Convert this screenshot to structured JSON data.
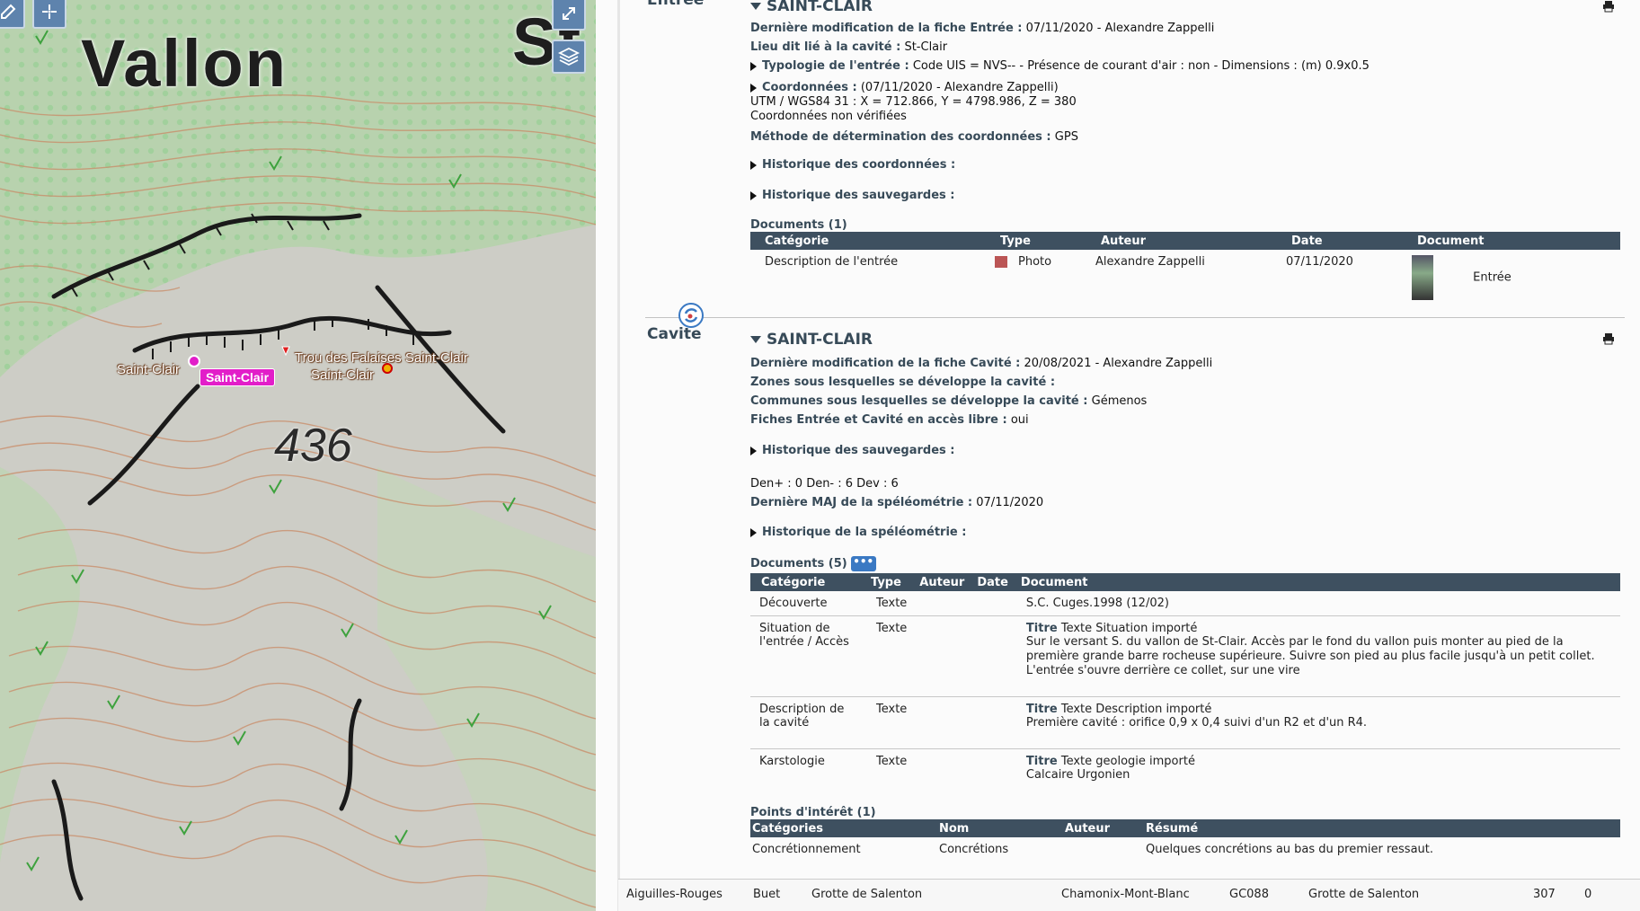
{
  "map": {
    "labels": {
      "vallon": "Vallon",
      "st": "St",
      "altitude": "436",
      "saint_clair_left": "Saint-Clair",
      "saint_clair_badge": "Saint-Clair",
      "trou": "Trou des Falaises Saint-Clair",
      "saint_clair_right": "Saint-Clair"
    },
    "buttons": {
      "fullscreen_icon": "expand-icon",
      "layers_icon": "layers-icon"
    },
    "colors": {
      "badge": "#e21ec9",
      "button": "#5e83ad"
    }
  },
  "entree": {
    "section_label": "Entrée",
    "title": "SAINT-CLAIR",
    "last_mod_label": "Dernière modification de la fiche Entrée :",
    "last_mod_value": "07/11/2020 - Alexandre Zappelli",
    "lieu_label": "Lieu dit lié à la cavité :",
    "lieu_value": "St-Clair",
    "typologie_label": "Typologie de l'entrée :",
    "typologie_value": "Code UIS = NVS--  -  Présence de courant d'air : non  -  Dimensions : (m) 0.9x0.5",
    "coord_label": "Coordonnées :",
    "coord_value": "(07/11/2020 - Alexandre Zappelli)",
    "utm": "UTM / WGS84 31 : X = 712.866, Y = 4798.986, Z = 380",
    "coord_status": "Coordonnées non vérifiées",
    "methode_label": "Méthode de détermination des coordonnées :",
    "methode_value": "GPS",
    "hist_coord": "Historique des coordonnées :",
    "hist_sauv": "Historique des sauvegardes :",
    "documents_title": "Documents (1)",
    "doc_headers": [
      "Catégorie",
      "Type",
      "Auteur",
      "Date",
      "Document"
    ],
    "doc_row": {
      "categorie": "Description de l'entrée",
      "type": "Photo",
      "auteur": "Alexandre Zappelli",
      "date": "07/11/2020",
      "document": "Entrée"
    }
  },
  "cavite": {
    "section_label": "Cavite",
    "title": "SAINT-CLAIR",
    "last_mod_label": "Dernière modification de la fiche Cavité :",
    "last_mod_value": "20/08/2021 - Alexandre Zappelli",
    "zones_label": "Zones sous lesquelles se développe la cavité :",
    "communes_label": "Communes sous lesquelles se développe la cavité :",
    "communes_value": "Gémenos",
    "fiches_label": "Fiches Entrée et Cavité en accès libre :",
    "fiches_value": "oui",
    "hist_sauv": "Historique des sauvegardes :",
    "den": "Den+ : 0 Den- : 6 Dev : 6",
    "maj_label": "Dernière MAJ de la spéléométrie :",
    "maj_value": "07/11/2020",
    "hist_speleo": "Historique de la spéléométrie :",
    "documents_title": "Documents (5)",
    "more_label": "•••",
    "doc_headers": [
      "Catégorie",
      "Type",
      "Auteur",
      "Date",
      "Document"
    ],
    "doc_rows": [
      {
        "categorie": "Découverte",
        "type": "Texte",
        "titre": "",
        "document": "S.C. Cuges.1998 (12/02)"
      },
      {
        "categorie": "Situation de l'entrée / Accès",
        "type": "Texte",
        "titre": "Titre",
        "document": "Texte Situation importé",
        "body": "Sur le versant S. du vallon de St-Clair. Accès par le fond du vallon puis monter au pied de la première grande barre rocheuse supérieure. Suivre son pied au plus facile jusqu'à un petit collet. L'entrée s'ouvre derrière ce collet, sur une vire"
      },
      {
        "categorie": "Description de la cavité",
        "type": "Texte",
        "titre": "Titre",
        "document": "Texte Description importé",
        "body": "Première cavité : orifice 0,9 x 0,4 suivi d'un R2 et d'un R4."
      },
      {
        "categorie": "Karstologie",
        "type": "Texte",
        "titre": "Titre",
        "document": "Texte geologie importé",
        "body": "Calcaire Urgonien"
      }
    ],
    "points_title": "Points d'intérêt (1)",
    "points_headers": [
      "Catégories",
      "Nom",
      "Auteur",
      "Résumé"
    ],
    "points_row": {
      "categorie": "Concrétionnement",
      "nom": "Concrétions",
      "auteur": "",
      "resume": "Quelques concrétions au bas du premier ressaut."
    }
  },
  "bottom_row": {
    "massif": "Aiguilles-Rouges",
    "lieu": "Buet",
    "nom": "Grotte de Salenton",
    "commune": "Chamonix-Mont-Blanc",
    "code": "GC088",
    "nom2": "Grotte de Salenton",
    "n1": "307",
    "n2": "0"
  }
}
